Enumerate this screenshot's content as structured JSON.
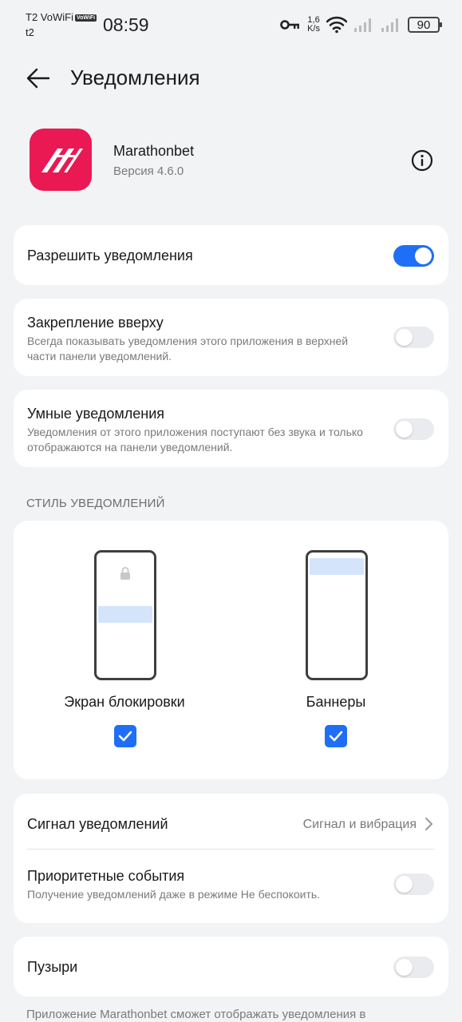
{
  "status_bar": {
    "carrier1": "T2 VoWiFi",
    "vowifi_badge": "VoWiFi",
    "carrier2": "t2",
    "time": "08:59",
    "speed_value": "1,6",
    "speed_unit": "K/s",
    "battery": "90"
  },
  "header": {
    "title": "Уведомления"
  },
  "app": {
    "name": "Marathonbet",
    "version": "Версия 4.6.0"
  },
  "allow": {
    "label": "Разрешить уведомления",
    "enabled": true
  },
  "pin_top": {
    "label": "Закрепление вверху",
    "description": "Всегда показывать уведомления этого приложения в верхней части панели уведомлений.",
    "enabled": false
  },
  "smart": {
    "label": "Умные уведомления",
    "description": "Уведомления от этого приложения поступают без звука и только отображаются на панели уведомлений.",
    "enabled": false
  },
  "style": {
    "section_label": "СТИЛЬ УВЕДОМЛЕНИЙ",
    "lock_screen": {
      "label": "Экран блокировки",
      "checked": true
    },
    "banners": {
      "label": "Баннеры",
      "checked": true
    }
  },
  "signal": {
    "label": "Сигнал уведомлений",
    "value": "Сигнал и вибрация"
  },
  "priority": {
    "label": "Приоритетные события",
    "description": "Получение уведомлений даже в режиме Не беспокоить.",
    "enabled": false
  },
  "bubbles": {
    "label": "Пузыри",
    "enabled": false
  },
  "footer": {
    "text": "Приложение Marathonbet сможет отображать уведомления в"
  },
  "colors": {
    "accent": "#1e6ff5",
    "app_icon": "#ea1853",
    "background": "#f1f3f5"
  }
}
